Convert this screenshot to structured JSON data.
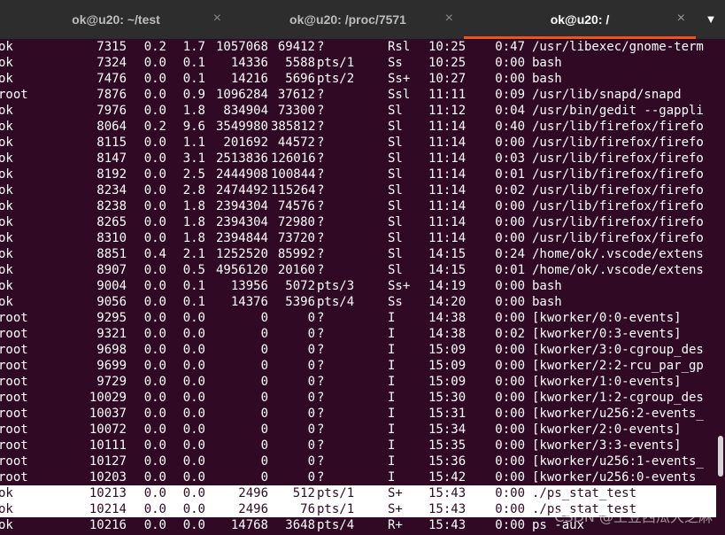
{
  "tabs": [
    {
      "title": "ok@u20: ~/test",
      "active": false
    },
    {
      "title": "ok@u20: /proc/7571",
      "active": false
    },
    {
      "title": "ok@u20: /",
      "active": true
    }
  ],
  "close_glyph": "×",
  "menu_glyph": "▼",
  "processes": [
    {
      "user": "ok",
      "pid": "7315",
      "cpu": "0.2",
      "mem": "1.7",
      "vsz": "1057068",
      "rss": "69412",
      "tty": "?",
      "stat": "Rsl",
      "start": "10:25",
      "time": "0:47",
      "cmd": "/usr/libexec/gnome-term"
    },
    {
      "user": "ok",
      "pid": "7324",
      "cpu": "0.0",
      "mem": "0.1",
      "vsz": "14336",
      "rss": "5588",
      "tty": "pts/1",
      "stat": "Ss",
      "start": "10:25",
      "time": "0:00",
      "cmd": "bash"
    },
    {
      "user": "ok",
      "pid": "7476",
      "cpu": "0.0",
      "mem": "0.1",
      "vsz": "14216",
      "rss": "5696",
      "tty": "pts/2",
      "stat": "Ss+",
      "start": "10:27",
      "time": "0:00",
      "cmd": "bash"
    },
    {
      "user": "root",
      "pid": "7876",
      "cpu": "0.0",
      "mem": "0.9",
      "vsz": "1096284",
      "rss": "37612",
      "tty": "?",
      "stat": "Ssl",
      "start": "11:11",
      "time": "0:09",
      "cmd": "/usr/lib/snapd/snapd"
    },
    {
      "user": "ok",
      "pid": "7976",
      "cpu": "0.0",
      "mem": "1.8",
      "vsz": "834904",
      "rss": "73300",
      "tty": "?",
      "stat": "Sl",
      "start": "11:12",
      "time": "0:04",
      "cmd": "/usr/bin/gedit --gappli"
    },
    {
      "user": "ok",
      "pid": "8064",
      "cpu": "0.2",
      "mem": "9.6",
      "vsz": "3549980",
      "rss": "385812",
      "tty": "?",
      "stat": "Sl",
      "start": "11:14",
      "time": "0:40",
      "cmd": "/usr/lib/firefox/firefo"
    },
    {
      "user": "ok",
      "pid": "8115",
      "cpu": "0.0",
      "mem": "1.1",
      "vsz": "201692",
      "rss": "44572",
      "tty": "?",
      "stat": "Sl",
      "start": "11:14",
      "time": "0:00",
      "cmd": "/usr/lib/firefox/firefo"
    },
    {
      "user": "ok",
      "pid": "8147",
      "cpu": "0.0",
      "mem": "3.1",
      "vsz": "2513836",
      "rss": "126016",
      "tty": "?",
      "stat": "Sl",
      "start": "11:14",
      "time": "0:03",
      "cmd": "/usr/lib/firefox/firefo"
    },
    {
      "user": "ok",
      "pid": "8192",
      "cpu": "0.0",
      "mem": "2.5",
      "vsz": "2444908",
      "rss": "100844",
      "tty": "?",
      "stat": "Sl",
      "start": "11:14",
      "time": "0:01",
      "cmd": "/usr/lib/firefox/firefo"
    },
    {
      "user": "ok",
      "pid": "8234",
      "cpu": "0.0",
      "mem": "2.8",
      "vsz": "2474492",
      "rss": "115264",
      "tty": "?",
      "stat": "Sl",
      "start": "11:14",
      "time": "0:02",
      "cmd": "/usr/lib/firefox/firefo"
    },
    {
      "user": "ok",
      "pid": "8238",
      "cpu": "0.0",
      "mem": "1.8",
      "vsz": "2394304",
      "rss": "74576",
      "tty": "?",
      "stat": "Sl",
      "start": "11:14",
      "time": "0:00",
      "cmd": "/usr/lib/firefox/firefo"
    },
    {
      "user": "ok",
      "pid": "8265",
      "cpu": "0.0",
      "mem": "1.8",
      "vsz": "2394304",
      "rss": "72980",
      "tty": "?",
      "stat": "Sl",
      "start": "11:14",
      "time": "0:00",
      "cmd": "/usr/lib/firefox/firefo"
    },
    {
      "user": "ok",
      "pid": "8310",
      "cpu": "0.0",
      "mem": "1.8",
      "vsz": "2394844",
      "rss": "73720",
      "tty": "?",
      "stat": "Sl",
      "start": "11:14",
      "time": "0:00",
      "cmd": "/usr/lib/firefox/firefo"
    },
    {
      "user": "ok",
      "pid": "8851",
      "cpu": "0.4",
      "mem": "2.1",
      "vsz": "1252520",
      "rss": "85992",
      "tty": "?",
      "stat": "Sl",
      "start": "14:15",
      "time": "0:24",
      "cmd": "/home/ok/.vscode/extens"
    },
    {
      "user": "ok",
      "pid": "8907",
      "cpu": "0.0",
      "mem": "0.5",
      "vsz": "4956120",
      "rss": "20160",
      "tty": "?",
      "stat": "Sl",
      "start": "14:15",
      "time": "0:01",
      "cmd": "/home/ok/.vscode/extens"
    },
    {
      "user": "ok",
      "pid": "9004",
      "cpu": "0.0",
      "mem": "0.1",
      "vsz": "13956",
      "rss": "5072",
      "tty": "pts/3",
      "stat": "Ss+",
      "start": "14:19",
      "time": "0:00",
      "cmd": "bash"
    },
    {
      "user": "ok",
      "pid": "9056",
      "cpu": "0.0",
      "mem": "0.1",
      "vsz": "14376",
      "rss": "5396",
      "tty": "pts/4",
      "stat": "Ss",
      "start": "14:20",
      "time": "0:00",
      "cmd": "bash"
    },
    {
      "user": "root",
      "pid": "9295",
      "cpu": "0.0",
      "mem": "0.0",
      "vsz": "0",
      "rss": "0",
      "tty": "?",
      "stat": "I",
      "start": "14:38",
      "time": "0:00",
      "cmd": "[kworker/0:0-events]"
    },
    {
      "user": "root",
      "pid": "9321",
      "cpu": "0.0",
      "mem": "0.0",
      "vsz": "0",
      "rss": "0",
      "tty": "?",
      "stat": "I",
      "start": "14:38",
      "time": "0:02",
      "cmd": "[kworker/0:3-events]"
    },
    {
      "user": "root",
      "pid": "9698",
      "cpu": "0.0",
      "mem": "0.0",
      "vsz": "0",
      "rss": "0",
      "tty": "?",
      "stat": "I",
      "start": "15:09",
      "time": "0:00",
      "cmd": "[kworker/3:0-cgroup_des"
    },
    {
      "user": "root",
      "pid": "9699",
      "cpu": "0.0",
      "mem": "0.0",
      "vsz": "0",
      "rss": "0",
      "tty": "?",
      "stat": "I",
      "start": "15:09",
      "time": "0:00",
      "cmd": "[kworker/2:2-rcu_par_gp"
    },
    {
      "user": "root",
      "pid": "9729",
      "cpu": "0.0",
      "mem": "0.0",
      "vsz": "0",
      "rss": "0",
      "tty": "?",
      "stat": "I",
      "start": "15:09",
      "time": "0:00",
      "cmd": "[kworker/1:0-events]"
    },
    {
      "user": "root",
      "pid": "10029",
      "cpu": "0.0",
      "mem": "0.0",
      "vsz": "0",
      "rss": "0",
      "tty": "?",
      "stat": "I",
      "start": "15:30",
      "time": "0:00",
      "cmd": "[kworker/1:2-cgroup_des"
    },
    {
      "user": "root",
      "pid": "10037",
      "cpu": "0.0",
      "mem": "0.0",
      "vsz": "0",
      "rss": "0",
      "tty": "?",
      "stat": "I",
      "start": "15:31",
      "time": "0:00",
      "cmd": "[kworker/u256:2-events_"
    },
    {
      "user": "root",
      "pid": "10072",
      "cpu": "0.0",
      "mem": "0.0",
      "vsz": "0",
      "rss": "0",
      "tty": "?",
      "stat": "I",
      "start": "15:34",
      "time": "0:00",
      "cmd": "[kworker/2:0-events]"
    },
    {
      "user": "root",
      "pid": "10111",
      "cpu": "0.0",
      "mem": "0.0",
      "vsz": "0",
      "rss": "0",
      "tty": "?",
      "stat": "I",
      "start": "15:35",
      "time": "0:00",
      "cmd": "[kworker/3:3-events]"
    },
    {
      "user": "root",
      "pid": "10127",
      "cpu": "0.0",
      "mem": "0.0",
      "vsz": "0",
      "rss": "0",
      "tty": "?",
      "stat": "I",
      "start": "15:36",
      "time": "0:00",
      "cmd": "[kworker/u256:1-events_"
    },
    {
      "user": "root",
      "pid": "10203",
      "cpu": "0.0",
      "mem": "0.0",
      "vsz": "0",
      "rss": "0",
      "tty": "?",
      "stat": "I",
      "start": "15:42",
      "time": "0:00",
      "cmd": "[kworker/u256:0-events"
    },
    {
      "user": "ok",
      "pid": "10213",
      "cpu": "0.0",
      "mem": "0.0",
      "vsz": "2496",
      "rss": "512",
      "tty": "pts/1",
      "stat": "S+",
      "start": "15:43",
      "time": "0:00",
      "cmd": "./ps_stat_test",
      "highlight": true
    },
    {
      "user": "ok",
      "pid": "10214",
      "cpu": "0.0",
      "mem": "0.0",
      "vsz": "2496",
      "rss": "76",
      "tty": "pts/1",
      "stat": "S+",
      "start": "15:43",
      "time": "0:00",
      "cmd": "./ps_stat_test",
      "highlight": true
    },
    {
      "user": "ok",
      "pid": "10216",
      "cpu": "0.0",
      "mem": "0.0",
      "vsz": "14768",
      "rss": "3648",
      "tty": "pts/4",
      "stat": "R+",
      "start": "15:43",
      "time": "0:00",
      "cmd": "ps -aux"
    }
  ],
  "watermark": "CSDN @土豆西瓜大芝麻",
  "colors": {
    "background": "#300a24",
    "tabbar": "#2d2d2d",
    "accent": "#e95420",
    "text": "#ffffff"
  }
}
